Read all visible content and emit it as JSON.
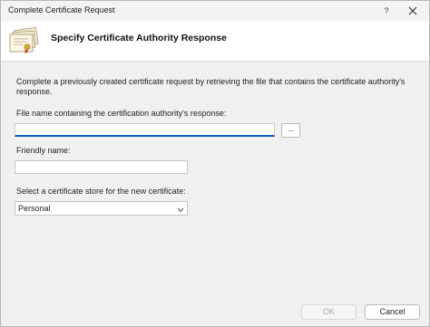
{
  "window": {
    "title": "Complete Certificate Request",
    "help_label": "?",
    "close_icon": "close-icon"
  },
  "header": {
    "title": "Specify Certificate Authority Response",
    "icon": "certificate-icon"
  },
  "content": {
    "description": "Complete a previously created certificate request by retrieving the file that contains the certificate authority's response.",
    "file_label": "File name containing the certification authority's response:",
    "file_value": "",
    "browse_label": "...",
    "friendly_label": "Friendly name:",
    "friendly_value": "",
    "store_label": "Select a certificate store for the new certificate:",
    "store_selected": "Personal"
  },
  "footer": {
    "ok_label": "OK",
    "cancel_label": "Cancel"
  },
  "colors": {
    "accent": "#0a5cbf",
    "header_bg": "#ffffff",
    "body_bg": "#f0f0f0"
  }
}
